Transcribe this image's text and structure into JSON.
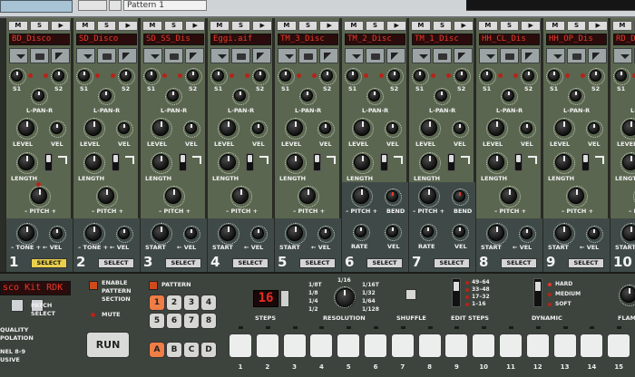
{
  "top": {
    "pattern_label": "Pattern 1"
  },
  "channel_header_buttons": [
    "M",
    "S",
    "▶"
  ],
  "channel_labels": {
    "s1": "S1",
    "s2": "S2",
    "pan": "L-PAN-R",
    "level": "LEVEL",
    "vel": "VEL",
    "length": "LENGTH",
    "pitch": "– PITCH +",
    "bend": "BEND",
    "tone": "– TONE +",
    "start": "START",
    "rate": "RATE",
    "arrow_vel": "← VEL",
    "select": "SELECT"
  },
  "channels": [
    {
      "num": "1",
      "name": "BD_Disco",
      "mode": "tone",
      "selected": true
    },
    {
      "num": "2",
      "name": "SD_Disco",
      "mode": "tone",
      "selected": false
    },
    {
      "num": "3",
      "name": "SD_SS_Dis",
      "mode": "start",
      "selected": false
    },
    {
      "num": "4",
      "name": "Eggi.aif",
      "mode": "start",
      "selected": false
    },
    {
      "num": "5",
      "name": "TM_3_Disc",
      "mode": "start",
      "selected": false
    },
    {
      "num": "6",
      "name": "TM_2_Disc",
      "mode": "bend",
      "selected": false
    },
    {
      "num": "7",
      "name": "TM_1_Disc",
      "mode": "bend",
      "selected": false
    },
    {
      "num": "8",
      "name": "HH_CL_Dis",
      "mode": "start",
      "selected": false
    },
    {
      "num": "9",
      "name": "HH_OP_Dis",
      "mode": "start",
      "selected": false
    },
    {
      "num": "10",
      "name": "RD_Dis",
      "mode": "start",
      "selected": false
    }
  ],
  "bottom": {
    "kit_name": "sco Kit RDK",
    "patch_select": "PATCH\nSELECT",
    "quality": "QUALITY\nPOLATION",
    "channel89": "NEL 8-9\nUSIVE",
    "enable_pattern": "ENABLE\nPATTERN\nSECTION",
    "mute": "MUTE",
    "run": "RUN",
    "pattern": "PATTERN",
    "pattern_buttons": [
      "1",
      "2",
      "3",
      "4",
      "5",
      "6",
      "7",
      "8"
    ],
    "bank_buttons": [
      "A",
      "B",
      "C",
      "D"
    ],
    "steps_value": "16",
    "steps_label": "STEPS",
    "resolution_label": "RESOLUTION",
    "resolution_left": [
      "1/8T",
      "1/8",
      "1/4",
      "1/2"
    ],
    "resolution_right": [
      "1/16T",
      "1/32",
      "1/64",
      "1/128"
    ],
    "resolution_top": "1/16",
    "shuffle_label": "SHUFFLE",
    "edit_steps_label": "EDIT STEPS",
    "edit_steps_options": [
      "49–64",
      "33–48",
      "17–32",
      "1–16"
    ],
    "dynamic_label": "DYNAMIC",
    "dynamic_options": [
      "HARD",
      "MEDIUM",
      "SOFT"
    ],
    "flam_label": "FLAM",
    "step_numbers": [
      "1",
      "2",
      "3",
      "4",
      "5",
      "6",
      "7",
      "8",
      "9",
      "10",
      "11",
      "12",
      "13",
      "14",
      "15"
    ]
  }
}
